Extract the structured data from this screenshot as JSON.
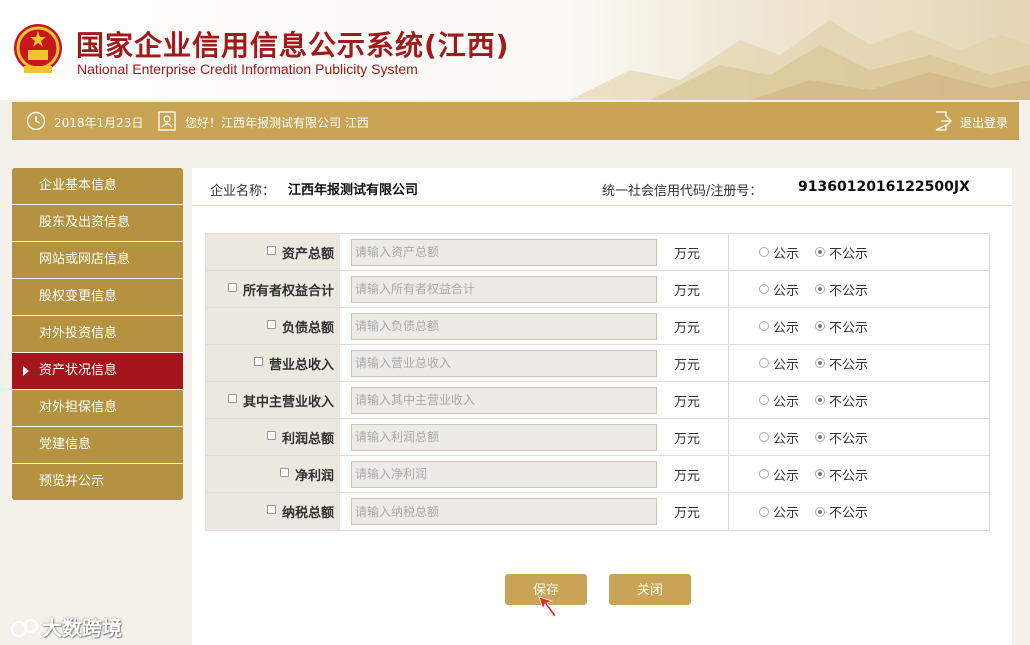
{
  "header": {
    "title_cn": "国家企业信用信息公示系统(江西)",
    "title_en": "National Enterprise Credit Information Publicity System"
  },
  "infobar": {
    "date": "2018年1月23日",
    "greeting": "您好！江西年报测试有限公司  江西",
    "logout": "退出登录"
  },
  "sidebar": {
    "items": [
      {
        "label": "企业基本信息"
      },
      {
        "label": "股东及出资信息"
      },
      {
        "label": "网站或网店信息"
      },
      {
        "label": "股权变更信息"
      },
      {
        "label": "对外投资信息"
      },
      {
        "label": "资产状况信息",
        "active": true
      },
      {
        "label": "对外担保信息"
      },
      {
        "label": "党建信息"
      },
      {
        "label": "预览并公示"
      }
    ]
  },
  "company": {
    "name_label": "企业名称：",
    "name_value": "江西年报测试有限公司",
    "code_label": "统一社会信用代码/注册号：",
    "code_value": "9136012016122500JX"
  },
  "form": {
    "unit": "万元",
    "public_label": "公示",
    "private_label": "不公示",
    "rows": [
      {
        "label": "资产总额",
        "placeholder": "请输入资产总额"
      },
      {
        "label": "所有者权益合计",
        "placeholder": "请输入所有者权益合计"
      },
      {
        "label": "负债总额",
        "placeholder": "请输入负债总额"
      },
      {
        "label": "营业总收入",
        "placeholder": "请输入营业总收入"
      },
      {
        "label": "其中主营业收入",
        "placeholder": "请输入其中主营业收入"
      },
      {
        "label": "利润总额",
        "placeholder": "请输入利润总额"
      },
      {
        "label": "净利润",
        "placeholder": "请输入净利润"
      },
      {
        "label": "纳税总额",
        "placeholder": "请输入纳税总额"
      }
    ]
  },
  "buttons": {
    "save": "保存",
    "close": "关闭"
  },
  "watermark": "大数跨境",
  "colors": {
    "brand_red": "#a0191b",
    "gold": "#c9a356",
    "nav_gold": "#b4923f",
    "nav_active": "#a3161c"
  }
}
